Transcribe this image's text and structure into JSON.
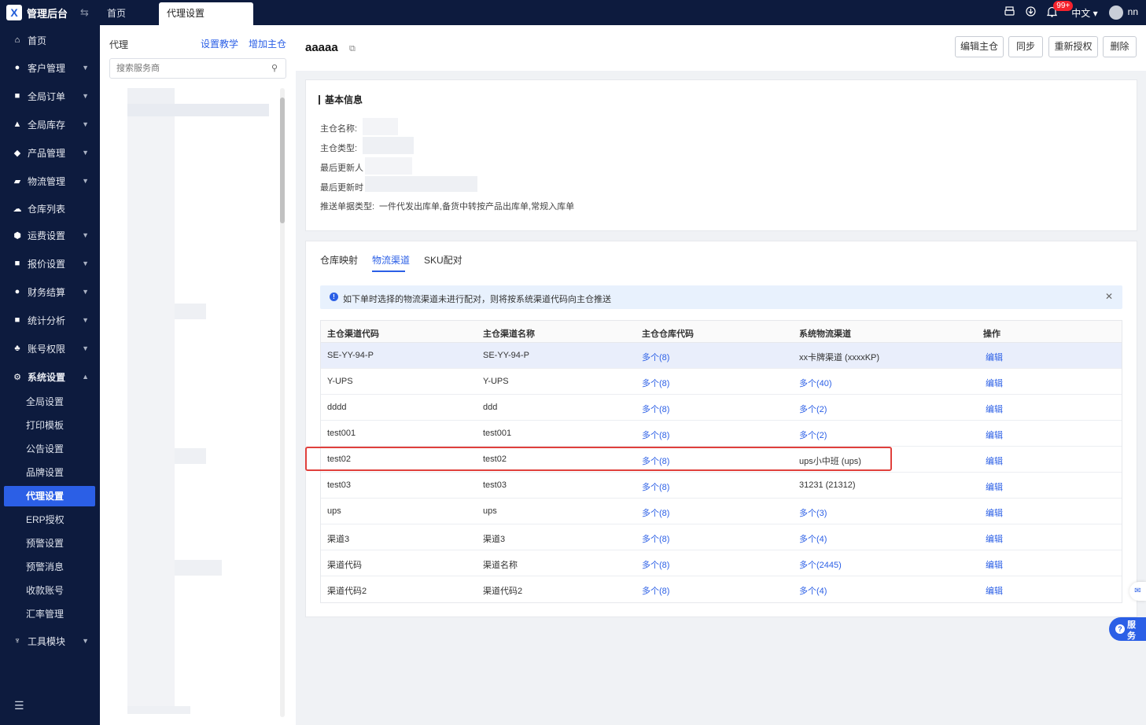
{
  "app": {
    "title": "管理后台",
    "logo_glyph": "X"
  },
  "tabs": [
    {
      "label": "首页"
    },
    {
      "label": "代理设置"
    }
  ],
  "header_right": {
    "badge": "99+",
    "language": "中文",
    "user": "nn"
  },
  "sidebar": {
    "items": [
      {
        "label": "首页",
        "icon": "home-icon"
      },
      {
        "label": "客户管理",
        "icon": "customer-icon"
      },
      {
        "label": "全局订单",
        "icon": "order-icon"
      },
      {
        "label": "全局库存",
        "icon": "inventory-icon"
      },
      {
        "label": "产品管理",
        "icon": "product-icon"
      },
      {
        "label": "物流管理",
        "icon": "truck-icon"
      },
      {
        "label": "仓库列表",
        "icon": "warehouse-icon"
      },
      {
        "label": "运费设置",
        "icon": "freight-icon"
      },
      {
        "label": "报价设置",
        "icon": "quote-icon"
      },
      {
        "label": "财务结算",
        "icon": "finance-icon"
      },
      {
        "label": "统计分析",
        "icon": "stats-icon"
      },
      {
        "label": "账号权限",
        "icon": "account-icon"
      },
      {
        "label": "系统设置",
        "icon": "settings-icon"
      }
    ],
    "sub_items": [
      "全局设置",
      "打印模板",
      "公告设置",
      "品牌设置",
      "代理设置",
      "ERP授权",
      "预警设置",
      "预警消息",
      "收款账号",
      "汇率管理"
    ],
    "tools": {
      "label": "工具模块",
      "icon": "tools-icon"
    }
  },
  "agent_panel": {
    "title": "代理",
    "link_tutorial": "设置教学",
    "link_add": "增加主仓",
    "search_placeholder": "搜索服务商"
  },
  "main": {
    "title": "aaaaa",
    "buttons": {
      "edit": "编辑主仓",
      "sync": "同步",
      "reauth": "重新授权",
      "delete": "删除"
    },
    "basic_info": {
      "title": "基本信息",
      "labels": {
        "name": "主仓名称:",
        "type": "主仓类型:",
        "updater": "最后更新人",
        "updated_at": "最后更新时",
        "push_types": "推送单据类型:"
      },
      "push_types_value": "一件代发出库单,备货中转按产品出库单,常规入库单"
    },
    "tabs": [
      "仓库映射",
      "物流渠道",
      "SKU配对"
    ],
    "notice": "如下单时选择的物流渠道未进行配对，则将按系统渠道代码向主仓推送",
    "table": {
      "headers": [
        "主仓渠道代码",
        "主仓渠道名称",
        "主仓仓库代码",
        "系统物流渠道",
        "操作"
      ],
      "rows": [
        {
          "code": "SE-YY-94-P",
          "name": "SE-YY-94-P",
          "wh": "多个(8)",
          "sys": "xx卡牌渠道 (xxxxKP)",
          "sys_link": false,
          "op": "编辑"
        },
        {
          "code": "Y-UPS",
          "name": "Y-UPS",
          "wh": "多个(8)",
          "sys": "多个(40)",
          "sys_link": true,
          "op": "编辑"
        },
        {
          "code": "dddd",
          "name": "ddd",
          "wh": "多个(8)",
          "sys": "多个(2)",
          "sys_link": true,
          "op": "编辑"
        },
        {
          "code": "test001",
          "name": "test001",
          "wh": "多个(8)",
          "sys": "多个(2)",
          "sys_link": true,
          "op": "编辑"
        },
        {
          "code": "test02",
          "name": "test02",
          "wh": "多个(8)",
          "sys": "ups小中班 (ups)",
          "sys_link": false,
          "op": "编辑"
        },
        {
          "code": "test03",
          "name": "test03",
          "wh": "多个(8)",
          "sys": "31231 (21312)",
          "sys_link": false,
          "op": "编辑"
        },
        {
          "code": "ups",
          "name": "ups",
          "wh": "多个(8)",
          "sys": "多个(3)",
          "sys_link": true,
          "op": "编辑"
        },
        {
          "code": "渠道3",
          "name": "渠道3",
          "wh": "多个(8)",
          "sys": "多个(4)",
          "sys_link": true,
          "op": "编辑"
        },
        {
          "code": "渠道代码",
          "name": "渠道名称",
          "wh": "多个(8)",
          "sys": "多个(2445)",
          "sys_link": true,
          "op": "编辑"
        },
        {
          "code": "渠道代码2",
          "name": "渠道代码2",
          "wh": "多个(8)",
          "sys": "多个(4)",
          "sys_link": true,
          "op": "编辑"
        }
      ]
    }
  },
  "float_service": {
    "label1": "服",
    "label2": "务"
  },
  "colors": {
    "nav_bg": "#0d1b3e",
    "accent": "#2b5fe6",
    "highlight_box": "#e0403c"
  }
}
